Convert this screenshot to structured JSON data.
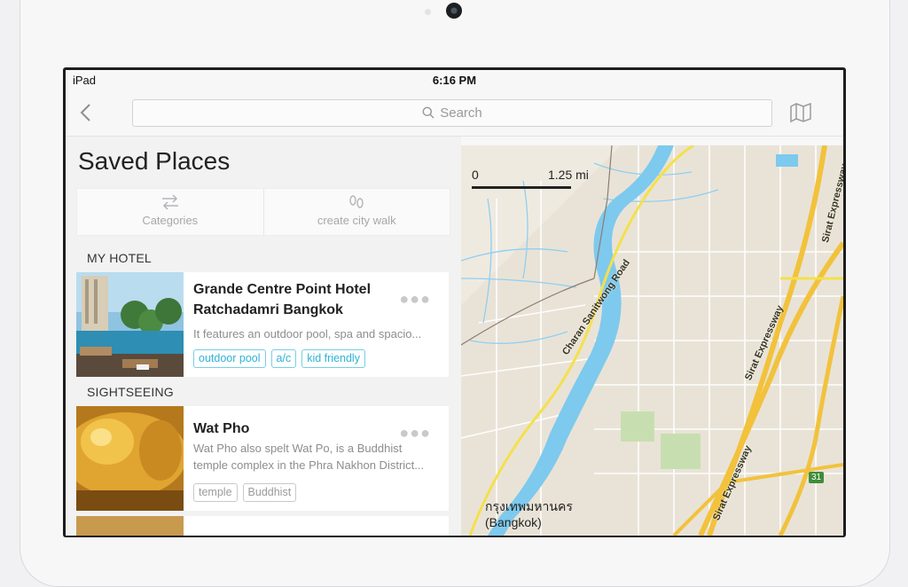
{
  "status": {
    "device": "iPad",
    "time": "6:16 PM"
  },
  "nav": {
    "search_placeholder": "Search"
  },
  "header": {
    "title": "Saved Places"
  },
  "actions": [
    {
      "label": "Categories",
      "icon": "swap-arrows-icon"
    },
    {
      "label": "create city walk",
      "icon": "footprints-icon"
    }
  ],
  "sections": [
    {
      "label": "MY HOTEL",
      "place": {
        "name_line1": "Grande Centre Point Hotel",
        "name_line2": "Ratchadamri Bangkok",
        "description": "It features an outdoor pool, spa and spacio...",
        "tags": [
          "outdoor pool",
          "a/c",
          "kid friendly"
        ]
      }
    },
    {
      "label": "SIGHTSEEING",
      "place": {
        "name_line1": "Wat Pho",
        "description_line1": "Wat Pho also spelt Wat Po, is a Buddhist",
        "description_line2": "temple complex in the Phra Nakhon District...",
        "tags": [
          "temple",
          "Buddhist"
        ]
      }
    }
  ],
  "map": {
    "scale_start": "0",
    "scale_distance": "1.25 mi",
    "roads": [
      "Charan Sanitwong Road",
      "Sirat Expressway",
      "Sirat Expressway",
      "Sirat Expressway"
    ],
    "city_thai": "กรุงเทพมหานคร",
    "city_english": "(Bangkok)",
    "route_shield": "31"
  },
  "colors": {
    "tag_blue": "#2fb3d6",
    "river": "#7ec9ee",
    "expressway": "#f2c23c"
  }
}
